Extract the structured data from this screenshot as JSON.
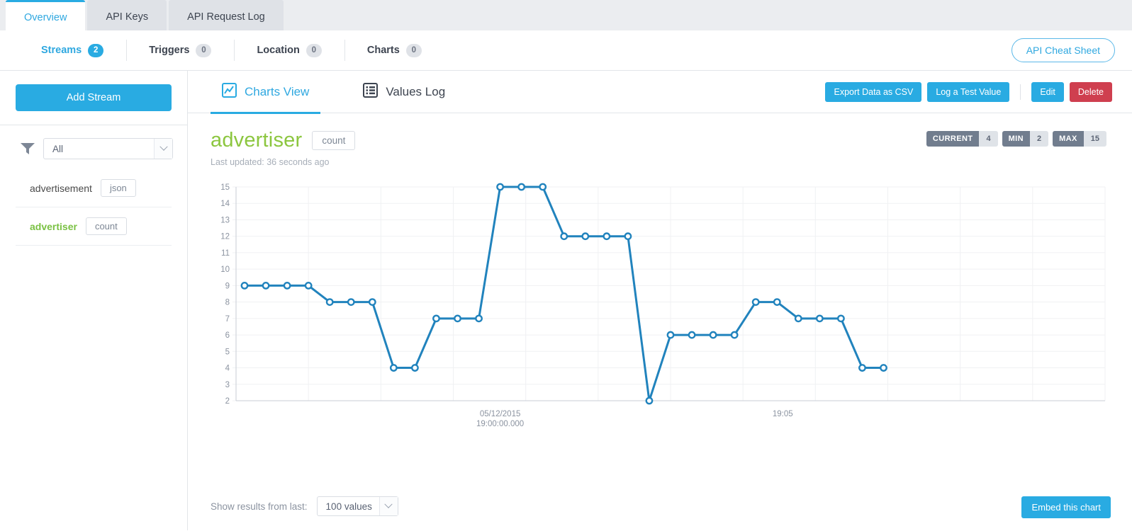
{
  "tabs": [
    {
      "label": "Overview",
      "active": true
    },
    {
      "label": "API Keys",
      "active": false
    },
    {
      "label": "API Request Log",
      "active": false
    }
  ],
  "stats": {
    "items": [
      {
        "label": "Streams",
        "count": "2",
        "active": true
      },
      {
        "label": "Triggers",
        "count": "0",
        "active": false
      },
      {
        "label": "Location",
        "count": "0",
        "active": false
      },
      {
        "label": "Charts",
        "count": "0",
        "active": false
      }
    ],
    "cheat_sheet_label": "API Cheat Sheet"
  },
  "sidebar": {
    "add_stream_label": "Add Stream",
    "filter": {
      "value": "All",
      "icon": "funnel-icon"
    },
    "streams": [
      {
        "name": "advertisement",
        "type": "json",
        "selected": false
      },
      {
        "name": "advertiser",
        "type": "count",
        "selected": true
      }
    ]
  },
  "content": {
    "view_tabs": [
      {
        "label": "Charts View",
        "icon": "chart-area-icon",
        "active": true
      },
      {
        "label": "Values Log",
        "icon": "list-icon",
        "active": false
      }
    ],
    "actions": {
      "export_label": "Export Data as CSV",
      "log_test_label": "Log a Test Value",
      "edit_label": "Edit",
      "delete_label": "Delete"
    },
    "chart_header": {
      "title": "advertiser",
      "type_tag": "count",
      "last_updated": "Last updated: 36 seconds ago",
      "badges": [
        {
          "label": "CURRENT",
          "value": "4"
        },
        {
          "label": "MIN",
          "value": "2"
        },
        {
          "label": "MAX",
          "value": "15"
        }
      ]
    },
    "footer": {
      "show_results_label": "Show results from last:",
      "range_value": "100 values",
      "embed_label": "Embed this chart"
    }
  },
  "colors": {
    "accent": "#29abe2",
    "stream_green": "#8cc63f",
    "danger": "#cf3f4f",
    "line": "#2183bd",
    "badge": "#717d8e"
  },
  "chart_data": {
    "type": "line",
    "title": "advertiser",
    "series_name": "count",
    "xlabel": "",
    "ylabel": "",
    "ylim": [
      2,
      15
    ],
    "ytick_labels": [
      "15",
      "14",
      "13",
      "12",
      "11",
      "10",
      "9",
      "8",
      "7",
      "6",
      "5",
      "4",
      "3",
      "2"
    ],
    "yticks": [
      15,
      14,
      13,
      12,
      11,
      10,
      9,
      8,
      7,
      6,
      5,
      4,
      3,
      2
    ],
    "xtick_labels": [
      "05/12/2015\n19:00:00.000",
      "19:05"
    ],
    "xticks_primary": [
      "05/12/2015",
      "19:00:00.000"
    ],
    "xticks_secondary": [
      "19:05"
    ],
    "grid": true,
    "legend": "none",
    "values": [
      9,
      9,
      9,
      9,
      8,
      8,
      8,
      4,
      4,
      7,
      7,
      7,
      15,
      15,
      15,
      12,
      12,
      12,
      12,
      2,
      6,
      6,
      6,
      6,
      8,
      8,
      7,
      7,
      7,
      4,
      4
    ],
    "point_count": 31,
    "markers": true
  }
}
